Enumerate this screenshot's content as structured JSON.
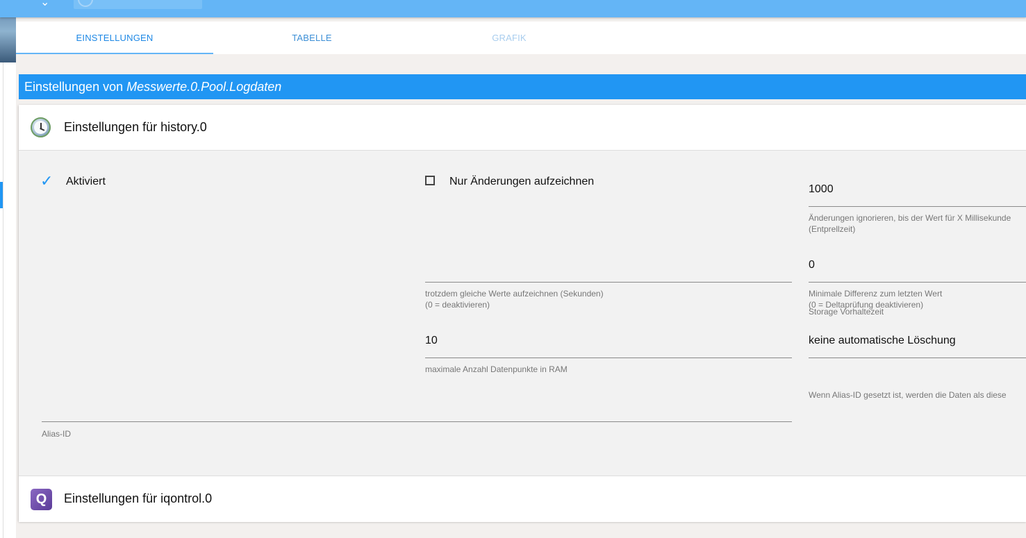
{
  "tabs": [
    {
      "label": "EINSTELLUNGEN"
    },
    {
      "label": "TABELLE"
    },
    {
      "label": "GRAFIK"
    }
  ],
  "header": {
    "prefix": "Einstellungen von",
    "object_id": "Messwerte.0.Pool.Logdaten"
  },
  "sections": {
    "history": {
      "title": "Einstellungen für history.0",
      "icon": "clock-icon",
      "enabled_label": "Aktiviert",
      "changes_only_label": "Nur Änderungen aufzeichnen",
      "debounce": {
        "value": "1000",
        "help_1": "Änderungen ignorieren, bis der Wert für X Millisekunde",
        "help_2": "(Entprellzeit)"
      },
      "same_values": {
        "value": "",
        "help_1": "trotzdem gleiche Werte aufzeichnen (Sekunden)",
        "help_2": "(0 = deaktivieren)"
      },
      "min_diff": {
        "value": "0",
        "help_1": "Minimale Differenz zum letzten Wert",
        "help_2": "(0 = Deltaprüfung deaktivieren)"
      },
      "max_points": {
        "value": "10",
        "help": "maximale Anzahl Datenpunkte in RAM"
      },
      "retention": {
        "label": "Storage Vorhaltezeit",
        "value": "keine automatische Löschung"
      },
      "alias_help": "Wenn Alias-ID gesetzt ist, werden die Daten als diese",
      "alias_label": "Alias-ID"
    },
    "iqontrol": {
      "title": "Einstellungen für iqontrol.0",
      "icon_letter": "Q"
    }
  },
  "colors": {
    "primary": "#2196f3",
    "topbar": "#64b5f6"
  }
}
